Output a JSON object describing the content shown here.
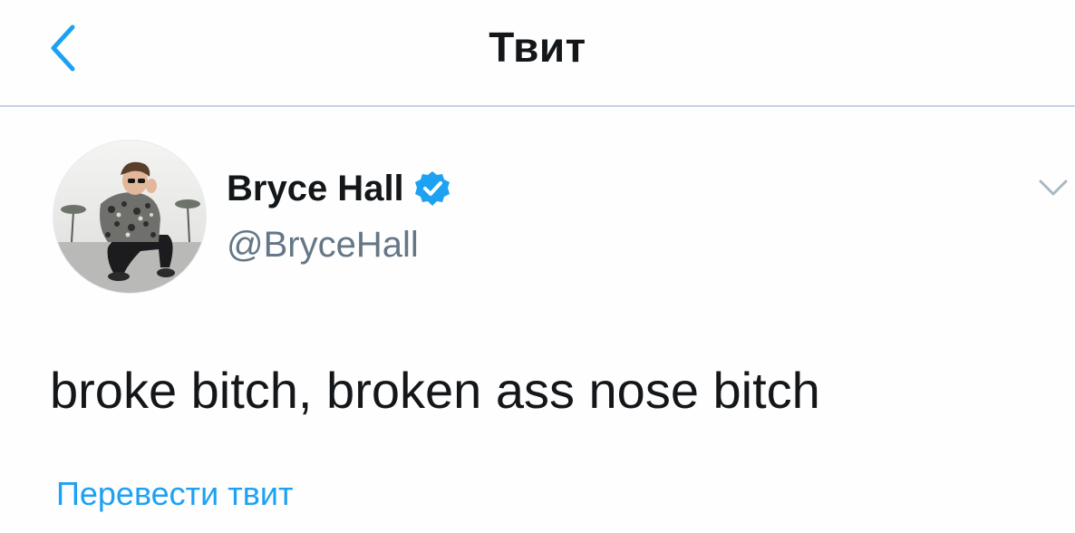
{
  "header": {
    "title": "Твит",
    "back_icon": "chevron-left-icon"
  },
  "tweet": {
    "display_name": "Bryce Hall",
    "verified": true,
    "verified_icon": "verified-badge-icon",
    "handle": "@BryceHall",
    "text": "broke bitch, broken ass nose bitch",
    "translate_label": "Перевести твит",
    "menu_icon": "chevron-down-icon"
  },
  "colors": {
    "accent": "#1da1f2",
    "text_primary": "#14171a",
    "text_secondary": "#657786",
    "divider": "#c5d5e2"
  }
}
